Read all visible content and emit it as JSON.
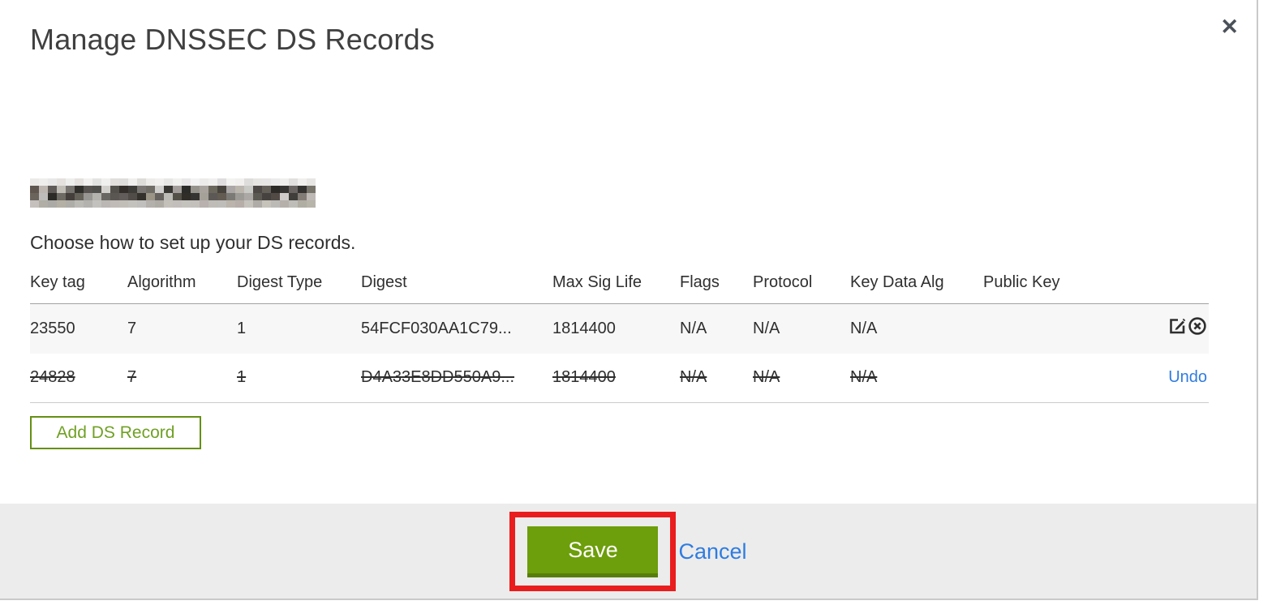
{
  "modal": {
    "title": "Manage DNSSEC DS Records",
    "close_icon": "✕",
    "domain": {
      "redacted": true
    },
    "instruction": "Choose how to set up your DS records."
  },
  "table": {
    "columns": [
      "Key tag",
      "Algorithm",
      "Digest Type",
      "Digest",
      "Max Sig Life",
      "Flags",
      "Protocol",
      "Key Data Alg",
      "Public Key"
    ],
    "rows": [
      {
        "key_tag": "23550",
        "algorithm": "7",
        "digest_type": "1",
        "digest": "54FCF030AA1C79...",
        "max_sig_life": "1814400",
        "flags": "N/A",
        "protocol": "N/A",
        "key_data_alg": "N/A",
        "public_key": "",
        "deleted": false,
        "actions": [
          "edit",
          "remove"
        ]
      },
      {
        "key_tag": "24828",
        "algorithm": "7",
        "digest_type": "1",
        "digest": "D4A33E8DD550A9...",
        "max_sig_life": "1814400",
        "flags": "N/A",
        "protocol": "N/A",
        "key_data_alg": "N/A",
        "public_key": "",
        "deleted": true,
        "undo_label": "Undo"
      }
    ]
  },
  "buttons": {
    "add_ds_record": "Add DS Record",
    "save": "Save",
    "cancel": "Cancel"
  },
  "colors": {
    "green_button": "#6d9e0b",
    "green_button_shade": "#577e09",
    "green_outline": "#649013",
    "link_blue": "#2f7ce0",
    "annotation_red": "#e91d1d",
    "footer_bg": "#ececec",
    "row_alt_bg": "#f7f7f7"
  }
}
